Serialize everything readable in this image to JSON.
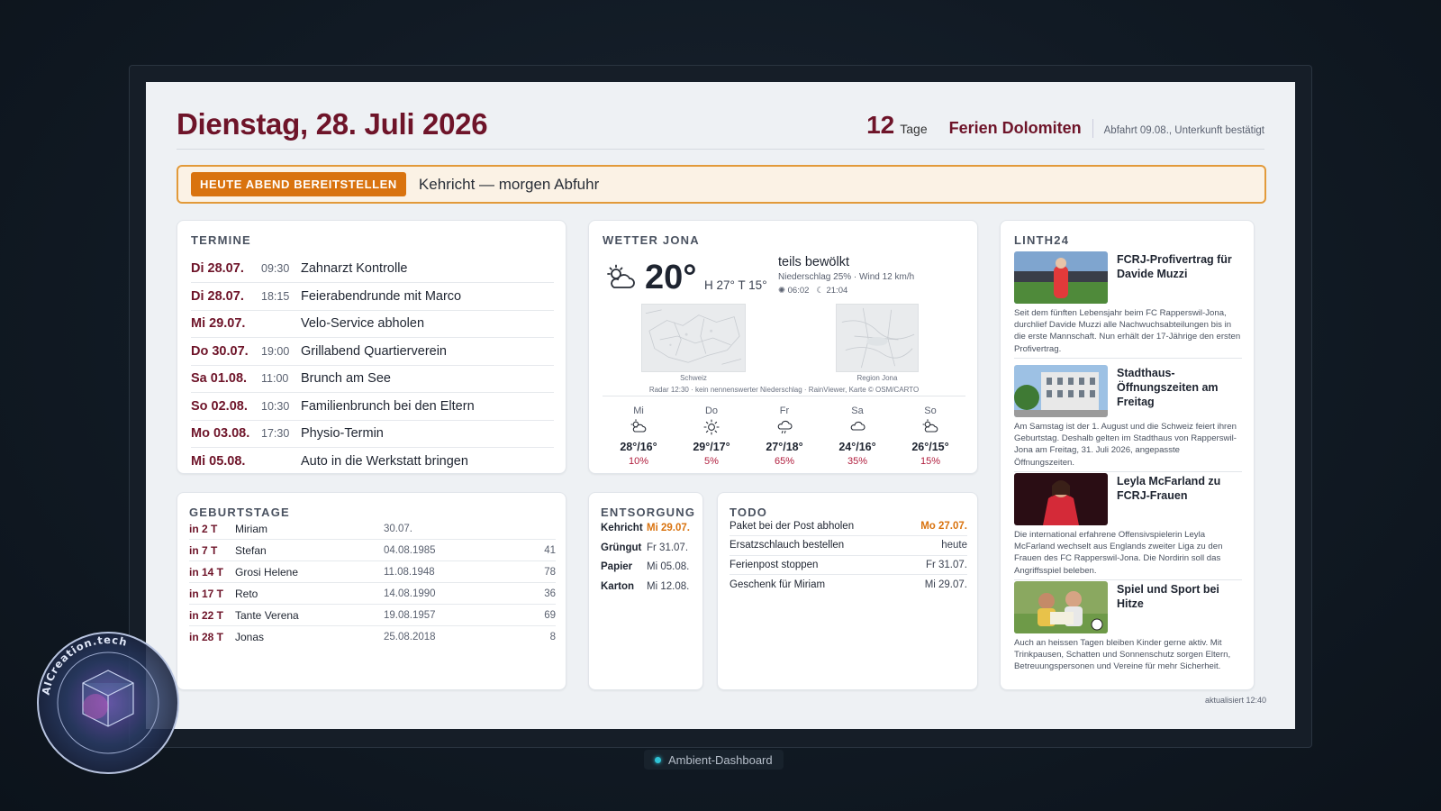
{
  "header": {
    "date": "Dienstag, 28. Juli 2026",
    "countdown_number": "12",
    "countdown_unit": "Tage",
    "countdown_title": "Ferien Dolomiten",
    "countdown_subtitle": "Abfahrt 09.08., Unterkunft bestätigt"
  },
  "alert": {
    "badge": "HEUTE ABEND BEREITSTELLEN",
    "text": "Kehricht — morgen Abfuhr"
  },
  "termine": {
    "title": "TERMINE",
    "items": [
      {
        "date": "Di 28.07.",
        "time": "09:30",
        "text": "Zahnarzt Kontrolle"
      },
      {
        "date": "Di 28.07.",
        "time": "18:15",
        "text": "Feierabendrunde mit Marco"
      },
      {
        "date": "Mi 29.07.",
        "time": "",
        "text": "Velo-Service abholen"
      },
      {
        "date": "Do 30.07.",
        "time": "19:00",
        "text": "Grillabend Quartierverein"
      },
      {
        "date": "Sa 01.08.",
        "time": "11:00",
        "text": "Brunch am See"
      },
      {
        "date": "So 02.08.",
        "time": "10:30",
        "text": "Familienbrunch bei den Eltern"
      },
      {
        "date": "Mo 03.08.",
        "time": "17:30",
        "text": "Physio-Termin"
      },
      {
        "date": "Mi 05.08.",
        "time": "",
        "text": "Auto in die Werkstatt bringen"
      }
    ]
  },
  "weather": {
    "title": "WETTER JONA",
    "icon": "partly-cloudy-icon",
    "temp": "20°",
    "hilo": "H 27° T 15°",
    "condition": "teils bewölkt",
    "precip_wind": "Niederschlag 25% · Wind 12 km/h",
    "sunrise": "06:02",
    "sunset": "21:04",
    "map1_label": "Schweiz",
    "map2_label": "Region Jona",
    "radar_note": "Radar 12:30 · kein nennenswerter Niederschlag · RainViewer, Karte © OSM/CARTO",
    "forecast": [
      {
        "day": "Mi",
        "icon": "partly-cloudy-icon",
        "temp": "28°/16°",
        "precip": "10%"
      },
      {
        "day": "Do",
        "icon": "sun-icon",
        "temp": "29°/17°",
        "precip": "5%"
      },
      {
        "day": "Fr",
        "icon": "rain-icon",
        "temp": "27°/18°",
        "precip": "65%"
      },
      {
        "day": "Sa",
        "icon": "cloud-icon",
        "temp": "24°/16°",
        "precip": "35%"
      },
      {
        "day": "So",
        "icon": "partly-cloudy-icon",
        "temp": "26°/15°",
        "precip": "15%"
      }
    ]
  },
  "news": {
    "title": "LINTH24",
    "items": [
      {
        "title": "FCRJ-Profivertrag für Davide Muzzi",
        "body": "Seit dem fünften Lebensjahr beim FC Rapperswil-Jona, durchlief Davide Muzzi alle Nachwuchsabteilungen bis in die erste Mannschaft. Nun erhält der 17-Jährige den ersten Profivertrag."
      },
      {
        "title": "Stadthaus-Öffnungszeiten am Freitag",
        "body": "Am Samstag ist der 1. August und die Schweiz feiert ihren Geburtstag. Deshalb gelten im Stadthaus von Rapperswil-Jona am Freitag, 31. Juli 2026, angepasste Öffnungszeiten."
      },
      {
        "title": "Leyla McFarland zu FCRJ-Frauen",
        "body": "Die international erfahrene Offensivspielerin Leyla McFarland wechselt aus Englands zweiter Liga zu den Frauen des FC Rapperswil-Jona. Die Nordirin soll das Angriffsspiel beleben."
      },
      {
        "title": "Spiel und Sport bei Hitze",
        "body": "Auch an heissen Tagen bleiben Kinder gerne aktiv. Mit Trinkpausen, Schatten und Sonnenschutz sorgen Eltern, Betreuungspersonen und Vereine für mehr Sicherheit."
      }
    ]
  },
  "birthdays": {
    "title": "GEBURTSTAGE",
    "items": [
      {
        "in": "in 2 T",
        "name": "Miriam",
        "date": "30.07.",
        "age": ""
      },
      {
        "in": "in 7 T",
        "name": "Stefan",
        "date": "04.08.1985",
        "age": "41"
      },
      {
        "in": "in 14 T",
        "name": "Grosi Helene",
        "date": "11.08.1948",
        "age": "78"
      },
      {
        "in": "in 17 T",
        "name": "Reto",
        "date": "14.08.1990",
        "age": "36"
      },
      {
        "in": "in 22 T",
        "name": "Tante Verena",
        "date": "19.08.1957",
        "age": "69"
      },
      {
        "in": "in 28 T",
        "name": "Jonas",
        "date": "25.08.2018",
        "age": "8"
      }
    ]
  },
  "waste": {
    "title": "ENTSORGUNG",
    "items": [
      {
        "type": "Kehricht",
        "date": "Mi 29.07."
      },
      {
        "type": "Grüngut",
        "date": "Fr 31.07."
      },
      {
        "type": "Papier",
        "date": "Mi 05.08."
      },
      {
        "type": "Karton",
        "date": "Mi 12.08."
      }
    ]
  },
  "todo": {
    "title": "TODO",
    "items": [
      {
        "text": "Paket bei der Post abholen",
        "due": "Mo 27.07."
      },
      {
        "text": "Ersatzschlauch bestellen",
        "due": "heute"
      },
      {
        "text": "Ferienpost stoppen",
        "due": "Fr 31.07."
      },
      {
        "text": "Geschenk für Miriam",
        "due": "Mi 29.07."
      }
    ]
  },
  "updated": "aktualisiert 12:40",
  "footer_label": "Ambient-Dashboard",
  "watermark_text": "AICreation.tech",
  "colors": {
    "accent": "#6e1429",
    "warning": "#d9730f",
    "precip": "#b01c3c",
    "status_dot": "#2fc3d6"
  }
}
